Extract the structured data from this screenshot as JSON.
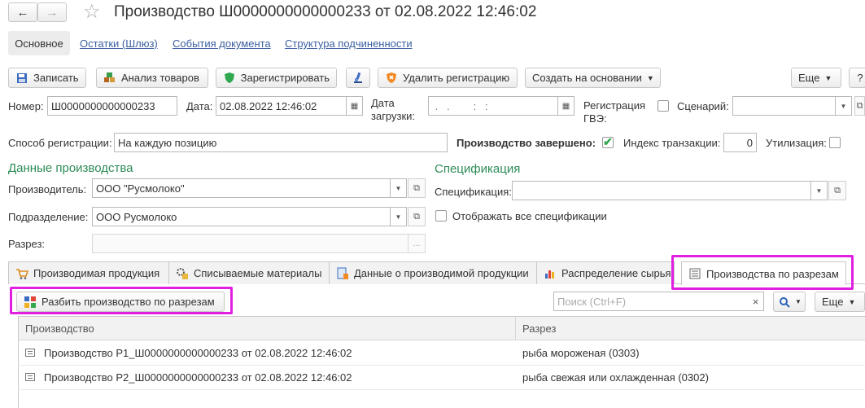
{
  "window": {
    "title": "Производство Ш0000000000000233 от 02.08.2022 12:46:02",
    "back_symbol": "←",
    "forward_symbol": "→",
    "star_symbol": "☆"
  },
  "nav_tabs": [
    {
      "label": "Основное"
    },
    {
      "label": "Остатки (Шлюз)"
    },
    {
      "label": "События документа"
    },
    {
      "label": "Структура подчиненности"
    }
  ],
  "toolbar": {
    "save": "Записать",
    "analyze": "Анализ товаров",
    "register": "Зарегистрировать",
    "delete_reg": "Удалить регистрацию",
    "create_based": "Создать на основании",
    "more": "Еще",
    "help": "?"
  },
  "header": {
    "number_label": "Номер:",
    "number_value": "Ш0000000000000233",
    "date_label": "Дата:",
    "date_value": "02.08.2022 12:46:02",
    "load_date_label_1": "Дата",
    "load_date_label_2": "загрузки:",
    "load_date_value": " .   .        :   :",
    "gve_label_1": "Регистрация",
    "gve_label_2": "ГВЭ:",
    "scenario_label": "Сценарий:",
    "scenario_value": "",
    "reg_method_label": "Способ регистрации:",
    "reg_method_value": "На каждую позицию",
    "completed_label": "Производство завершено:",
    "completed_check": "✔",
    "tx_index_label": "Индекс транзакции:",
    "tx_index_value": "0",
    "utilization_label": "Утилизация:"
  },
  "production": {
    "section_title": "Данные производства",
    "producer_label": "Производитель:",
    "producer_value": "ООО \"Русмолоко\"",
    "division_label": "Подразделение:",
    "division_value": "ООО Русмолоко",
    "cut_label": "Разрез:",
    "cut_value": "",
    "ellipsis": "..."
  },
  "specification": {
    "section_title": "Спецификация",
    "spec_label": "Спецификация:",
    "spec_value": "",
    "show_all_label": "Отображать все спецификации"
  },
  "tabs": [
    {
      "label": "Производимая продукция"
    },
    {
      "label": "Списываемые материалы"
    },
    {
      "label": "Данные о производимой продукции"
    },
    {
      "label": "Распределение сырья"
    },
    {
      "label": "Производства по разрезам"
    }
  ],
  "subtoolbar": {
    "split_button": "Разбить производство по разрезам",
    "search_placeholder": "Поиск (Ctrl+F)",
    "clear_symbol": "×",
    "more": "Еще"
  },
  "table": {
    "columns": [
      "Производство",
      "Разрез"
    ],
    "rows": [
      {
        "production": "Производство Р1_Ш0000000000000233 от 02.08.2022 12:46:02",
        "cut": "рыба мороженая (0303)"
      },
      {
        "production": "Производство Р2_Ш0000000000000233 от 02.08.2022 12:46:02",
        "cut": "рыба свежая или охлажденная (0302)"
      }
    ]
  },
  "colors": {
    "highlight": "#e020e0",
    "section": "#2e8b57",
    "link": "#3a5fa0"
  }
}
